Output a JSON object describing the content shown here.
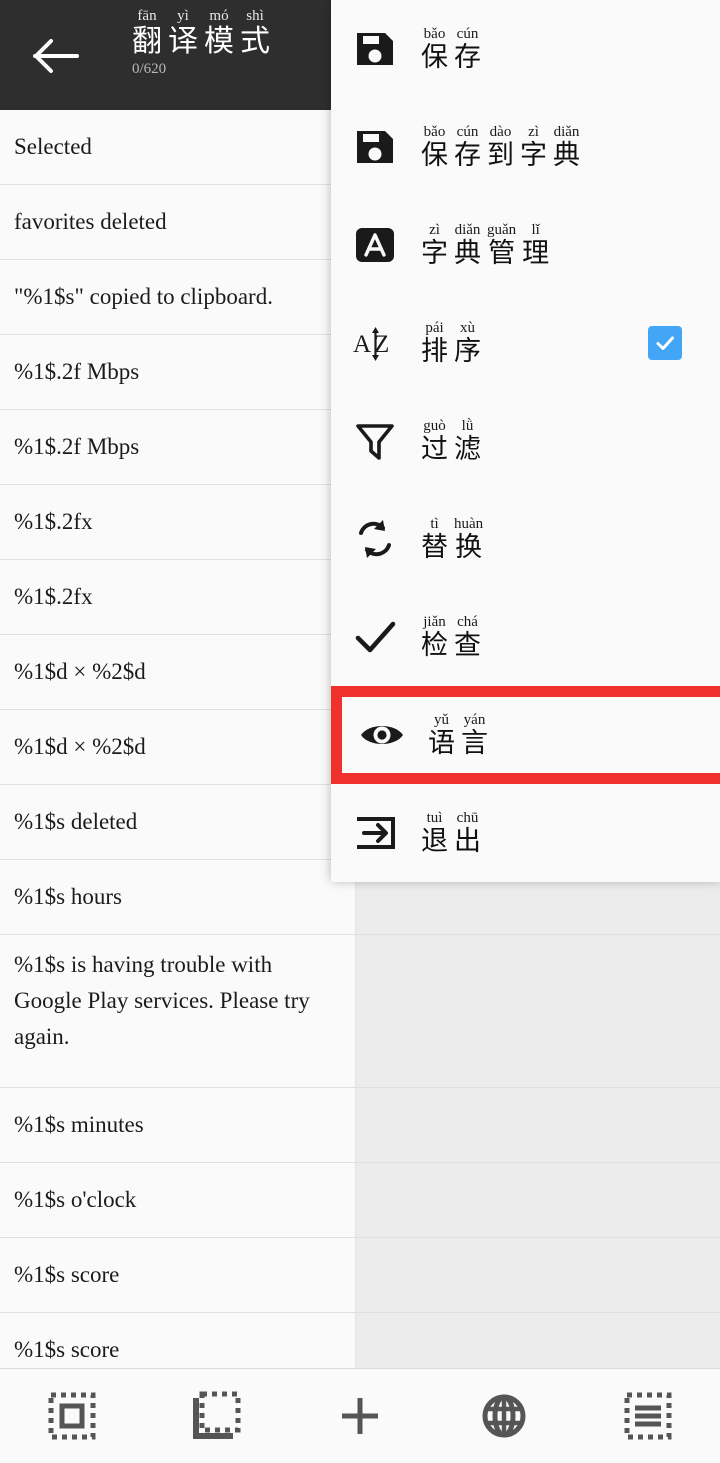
{
  "header": {
    "back_icon": "arrow-left-icon",
    "title_units": [
      {
        "pinyin": "fān",
        "char": "翻"
      },
      {
        "pinyin": "yì",
        "char": "译"
      },
      {
        "pinyin": "mó",
        "char": "模"
      },
      {
        "pinyin": "shì",
        "char": "式"
      }
    ],
    "count": "0/620",
    "bg_color": "#2e2e2e"
  },
  "list": {
    "rows": [
      {
        "text": "Selected",
        "tall": false
      },
      {
        "text": "favorites deleted",
        "tall": false
      },
      {
        "text": "\"%1$s\" copied to clipboard.",
        "tall": false
      },
      {
        "text": "%1$.2f Mbps",
        "tall": false
      },
      {
        "text": "%1$.2f Mbps",
        "tall": false
      },
      {
        "text": "%1$.2fx",
        "tall": false
      },
      {
        "text": "%1$.2fx",
        "tall": false
      },
      {
        "text": "%1$d × %2$d",
        "tall": false
      },
      {
        "text": "%1$d × %2$d",
        "tall": false
      },
      {
        "text": "%1$s deleted",
        "tall": false
      },
      {
        "text": "%1$s hours",
        "tall": false
      },
      {
        "text": "%1$s is having trouble with Google Play services. Please try again.",
        "tall": true
      },
      {
        "text": "%1$s minutes",
        "tall": false
      },
      {
        "text": "%1$s o'clock",
        "tall": false
      },
      {
        "text": "%1$s score",
        "tall": false
      },
      {
        "text": "%1$s score",
        "tall": false
      }
    ]
  },
  "menu": {
    "highlight_color": "#f0312d",
    "checkbox_color": "#42a5f5",
    "items": [
      {
        "icon": "save-floppy-icon",
        "pinyins": [
          "bǎo",
          "cún"
        ],
        "chars": [
          "保",
          "存"
        ],
        "checked": false,
        "highlighted": false
      },
      {
        "icon": "save-to-dictionary-icon",
        "pinyins": [
          "bǎo",
          "cún",
          "dào",
          "zì",
          "diǎn"
        ],
        "chars": [
          "保",
          "存",
          "到",
          "字",
          "典"
        ],
        "checked": false,
        "highlighted": false
      },
      {
        "icon": "dictionary-manage-icon",
        "pinyins": [
          "zì",
          "diǎn",
          "guǎn",
          "lǐ"
        ],
        "chars": [
          "字",
          "典",
          "管",
          "理"
        ],
        "checked": false,
        "highlighted": false
      },
      {
        "icon": "sort-az-icon",
        "pinyins": [
          "pái",
          "xù"
        ],
        "chars": [
          "排",
          "序"
        ],
        "checked": true,
        "highlighted": false
      },
      {
        "icon": "filter-funnel-icon",
        "pinyins": [
          "guò",
          "lǜ"
        ],
        "chars": [
          "过",
          "滤"
        ],
        "checked": false,
        "highlighted": false
      },
      {
        "icon": "replace-swap-icon",
        "pinyins": [
          "tì",
          "huàn"
        ],
        "chars": [
          "替",
          "换"
        ],
        "checked": false,
        "highlighted": false
      },
      {
        "icon": "check-mark-icon",
        "pinyins": [
          "jiǎn",
          "chá"
        ],
        "chars": [
          "检",
          "查"
        ],
        "checked": false,
        "highlighted": false
      },
      {
        "icon": "eye-icon",
        "pinyins": [
          "yǔ",
          "yán"
        ],
        "chars": [
          "语",
          "言"
        ],
        "checked": false,
        "highlighted": true
      },
      {
        "icon": "exit-arrow-icon",
        "pinyins": [
          "tuì",
          "chū"
        ],
        "chars": [
          "退",
          "出"
        ],
        "checked": false,
        "highlighted": false
      }
    ]
  },
  "toolbar": {
    "buttons": [
      {
        "icon": "select-all-dashed-icon"
      },
      {
        "icon": "select-partial-dashed-icon"
      },
      {
        "icon": "add-plus-icon"
      },
      {
        "icon": "globe-icon"
      },
      {
        "icon": "list-lines-dashed-icon"
      }
    ]
  }
}
